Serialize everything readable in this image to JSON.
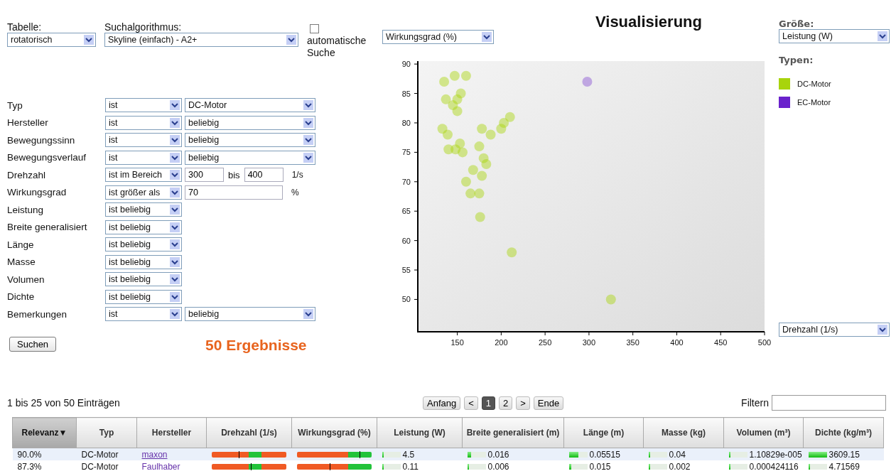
{
  "search_form": {
    "table_label": "Tabelle:",
    "table_value": "rotatorisch",
    "algorithm_label": "Suchalgorithmus:",
    "algorithm_value": "Skyline (einfach) - A2+",
    "auto_search": {
      "label": "automatische Suche",
      "checked": false
    },
    "filters": [
      {
        "label": "Typ",
        "kind": "select",
        "operator": "ist",
        "value": "DC-Motor"
      },
      {
        "label": "Hersteller",
        "kind": "select",
        "operator": "ist",
        "value": "beliebig"
      },
      {
        "label": "Bewegungssinn",
        "kind": "select",
        "operator": "ist",
        "value": "beliebig"
      },
      {
        "label": "Bewegungsverlauf",
        "kind": "select",
        "operator": "ist",
        "value": "beliebig"
      },
      {
        "label": "Drehzahl",
        "kind": "range",
        "operator": "ist im Bereich",
        "from": "300",
        "connector": "bis",
        "to": "400",
        "unit": "1/s"
      },
      {
        "label": "Wirkungsgrad",
        "kind": "input",
        "operator": "ist größer als",
        "value": "70",
        "unit": "%"
      },
      {
        "label": "Leistung",
        "kind": "operator",
        "operator": "ist beliebig"
      },
      {
        "label": "Breite generalisiert",
        "kind": "operator",
        "operator": "ist beliebig"
      },
      {
        "label": "Länge",
        "kind": "operator",
        "operator": "ist beliebig"
      },
      {
        "label": "Masse",
        "kind": "operator",
        "operator": "ist beliebig"
      },
      {
        "label": "Volumen",
        "kind": "operator",
        "operator": "ist beliebig"
      },
      {
        "label": "Dichte",
        "kind": "operator",
        "operator": "ist beliebig"
      },
      {
        "label": "Bemerkungen",
        "kind": "select",
        "operator": "ist",
        "value": "beliebig"
      }
    ],
    "search_button": "Suchen",
    "result_count": "50 Ergebnisse"
  },
  "visualization": {
    "title": "Visualisierung",
    "y_select": "Wirkungsgrad (%)",
    "x_select": "Drehzahl (1/s)",
    "size_label": "Größe:",
    "size_select": "Leistung (W)",
    "legend_title": "Typen:",
    "chart_data": {
      "type": "scatter",
      "xlim": [
        105,
        500
      ],
      "ylim": [
        44.5,
        90.5
      ],
      "xticks": [
        150,
        200,
        250,
        300,
        350,
        400,
        450,
        500
      ],
      "yticks": [
        50,
        55,
        60,
        65,
        70,
        75,
        80,
        85,
        90
      ],
      "series": [
        {
          "name": "DC-Motor",
          "color": "#a8d40c",
          "x": [
            135,
            147,
            160,
            137,
            150,
            145,
            154,
            150,
            133,
            139,
            140,
            148,
            153,
            156,
            178,
            200,
            203,
            210,
            188,
            175,
            180,
            183,
            168,
            160,
            165,
            175,
            178,
            176,
            212,
            325
          ],
          "values": [
            87,
            88,
            88,
            84,
            84,
            83,
            85,
            82,
            79,
            78,
            75.5,
            75.5,
            76.5,
            75,
            79,
            79,
            80,
            81,
            78,
            76,
            74,
            73,
            72,
            70,
            68,
            68,
            71,
            64,
            58,
            50
          ]
        },
        {
          "name": "EC-Motor",
          "color": "#6a22cc",
          "x": [
            298
          ],
          "values": [
            87
          ]
        }
      ]
    }
  },
  "results": {
    "summary": "1 bis 25 von 50 Einträgen",
    "pager": [
      {
        "label": "Anfang",
        "selected": false
      },
      {
        "label": "<",
        "selected": false
      },
      {
        "label": "1",
        "selected": true
      },
      {
        "label": "2",
        "selected": false
      },
      {
        "label": ">",
        "selected": false
      },
      {
        "label": "Ende",
        "selected": false
      }
    ],
    "filter_label": "Filtern",
    "table": {
      "columns": [
        {
          "label": "Relevanz",
          "sorted": true,
          "sort_indicator": "▼"
        },
        {
          "label": "Typ",
          "sorted": false
        },
        {
          "label": "Hersteller",
          "sorted": false
        },
        {
          "label": "Drehzahl (1/s)",
          "sorted": false
        },
        {
          "label": "Wirkungsgrad (%)",
          "sorted": false
        },
        {
          "label": "Leistung (W)",
          "sorted": false
        },
        {
          "label": "Breite generalisiert (m)",
          "sorted": false
        },
        {
          "label": "Länge (m)",
          "sorted": false
        },
        {
          "label": "Masse (kg)",
          "sorted": false
        },
        {
          "label": "Volumen (m³)",
          "sorted": false
        },
        {
          "label": "Dichte (kg/m³)",
          "sorted": false
        }
      ],
      "rows": [
        {
          "selected": true,
          "cells": [
            {
              "kind": "text",
              "text": "90.0%"
            },
            {
              "kind": "text",
              "text": "DC-Motor"
            },
            {
              "kind": "link",
              "text": "maxon",
              "underlined": true
            },
            {
              "kind": "range",
              "level": 0.37
            },
            {
              "kind": "range",
              "level": 0.84
            },
            {
              "kind": "bar",
              "text": "4.5",
              "level": 0.02
            },
            {
              "kind": "bar",
              "text": "0.016",
              "level": 0.2
            },
            {
              "kind": "bar",
              "text": "0.05515",
              "level": 0.5
            },
            {
              "kind": "bar",
              "text": "0.04",
              "level": 0.02
            },
            {
              "kind": "bar",
              "text": "1.10829e-005",
              "level": 0.02
            },
            {
              "kind": "bar",
              "text": "3609.15",
              "level": 1
            }
          ]
        },
        {
          "selected": false,
          "cells": [
            {
              "kind": "text",
              "text": "87.3%"
            },
            {
              "kind": "text",
              "text": "DC-Motor"
            },
            {
              "kind": "link",
              "text": "Faulhaber",
              "underlined": false
            },
            {
              "kind": "range",
              "level": 0.53
            },
            {
              "kind": "range",
              "level": 0.44
            },
            {
              "kind": "bar",
              "text": "0.11",
              "level": 0.02
            },
            {
              "kind": "bar",
              "text": "0.006",
              "level": 0.08
            },
            {
              "kind": "bar",
              "text": "0.015",
              "level": 0.15
            },
            {
              "kind": "bar",
              "text": "0.002",
              "level": 0.02
            },
            {
              "kind": "bar",
              "text": "0.000424116",
              "level": 0.02
            },
            {
              "kind": "bar",
              "text": "4.71569",
              "level": 0.02
            }
          ]
        }
      ]
    }
  }
}
